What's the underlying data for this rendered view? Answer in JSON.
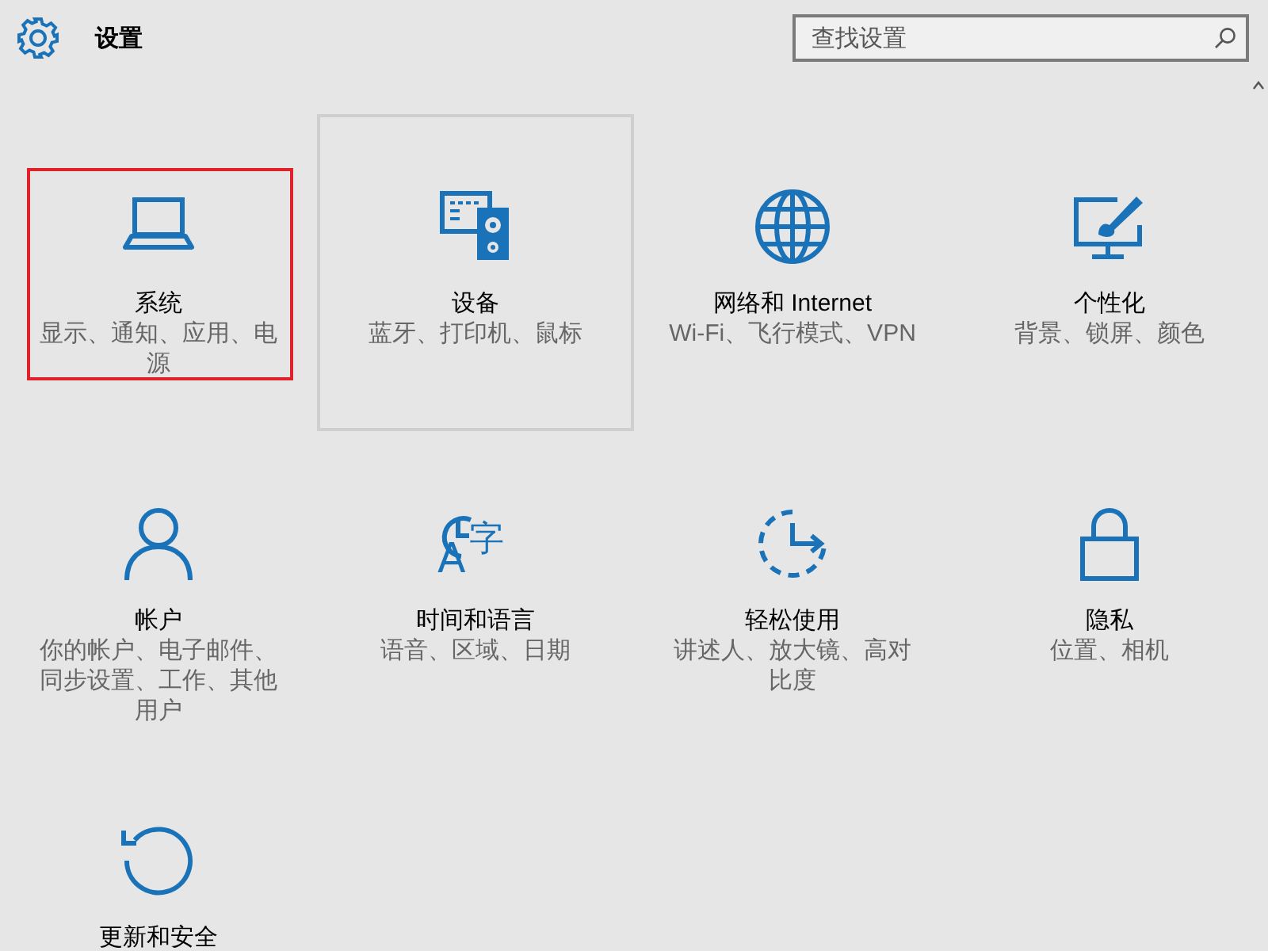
{
  "header": {
    "title": "设置",
    "search": {
      "placeholder": "查找设置"
    }
  },
  "tiles": [
    {
      "kind": "laptop",
      "title": "系统",
      "subtitle": "显示、通知、应用、电源",
      "hovered": false,
      "annotated": true
    },
    {
      "kind": "devices",
      "title": "设备",
      "subtitle": "蓝牙、打印机、鼠标",
      "hovered": true,
      "annotated": false
    },
    {
      "kind": "globe",
      "title": "网络和 Internet",
      "subtitle": "Wi-Fi、飞行模式、VPN",
      "hovered": false,
      "annotated": false
    },
    {
      "kind": "personalize",
      "title": "个性化",
      "subtitle": "背景、锁屏、颜色",
      "hovered": false,
      "annotated": false
    },
    {
      "kind": "person",
      "title": "帐户",
      "subtitle": "你的帐户、电子邮件、同步设置、工作、其他用户",
      "hovered": false,
      "annotated": false
    },
    {
      "kind": "time",
      "icon_letters": [
        "A",
        "字"
      ],
      "title": "时间和语言",
      "subtitle": "语音、区域、日期",
      "hovered": false,
      "annotated": false
    },
    {
      "kind": "ease",
      "title": "轻松使用",
      "subtitle": "讲述人、放大镜、高对比度",
      "hovered": false,
      "annotated": false
    },
    {
      "kind": "lock",
      "title": "隐私",
      "subtitle": "位置、相机",
      "hovered": false,
      "annotated": false
    },
    {
      "kind": "update",
      "title": "更新和安全",
      "hovered": false,
      "annotated": false
    }
  ]
}
